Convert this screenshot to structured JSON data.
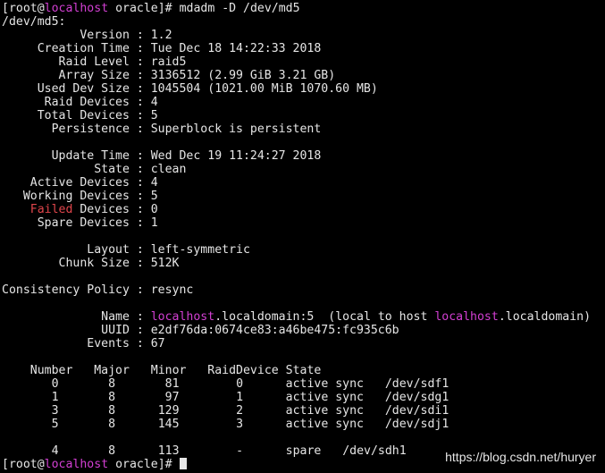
{
  "prompt_user": "root",
  "host": "localhost",
  "cwd": "oracle",
  "command": "mdadm -D /dev/md5",
  "device_path": "/dev/md5:",
  "version": "1.2",
  "creation_time": "Tue Dec 18 14:22:33 2018",
  "raid_level": "raid5",
  "array_size": "3136512 (2.99 GiB 3.21 GB)",
  "used_dev_size": "1045504 (1021.00 MiB 1070.60 MB)",
  "raid_devices": "4",
  "total_devices": "5",
  "persistence": "Superblock is persistent",
  "update_time": "Wed Dec 19 11:24:27 2018",
  "state": "clean",
  "active_devices": "4",
  "working_devices": "5",
  "failed_devices": "0",
  "spare_devices": "1",
  "layout": "left-symmetric",
  "chunk_size": "512K",
  "consistency_policy": "resync",
  "name_host": "localhost",
  "name_rest": ".localdomain:5",
  "name_note_pre": "(local to host ",
  "name_note_host": "localhost",
  "name_note_post": ".localdomain)",
  "uuid": "e2df76da:0674ce83:a46be475:fc935c6b",
  "events": "67",
  "table_headers": [
    "Number",
    "Major",
    "Minor",
    "RaidDevice",
    "State"
  ],
  "table_rows": [
    {
      "number": "0",
      "major": "8",
      "minor": "81",
      "raid": "0",
      "state": "active sync",
      "dev": "/dev/sdf1"
    },
    {
      "number": "1",
      "major": "8",
      "minor": "97",
      "raid": "1",
      "state": "active sync",
      "dev": "/dev/sdg1"
    },
    {
      "number": "3",
      "major": "8",
      "minor": "129",
      "raid": "2",
      "state": "active sync",
      "dev": "/dev/sdi1"
    },
    {
      "number": "5",
      "major": "8",
      "minor": "145",
      "raid": "3",
      "state": "active sync",
      "dev": "/dev/sdj1"
    }
  ],
  "spare_row": {
    "number": "4",
    "major": "8",
    "minor": "113",
    "raid": "-",
    "state": "spare",
    "dev": "/dev/sdh1"
  },
  "watermark": "https://blog.csdn.net/huryer",
  "colors": {
    "highlight": "#d33fd3",
    "failed": "#e0454b",
    "text": "#e6e6e6",
    "background": "#000000"
  }
}
